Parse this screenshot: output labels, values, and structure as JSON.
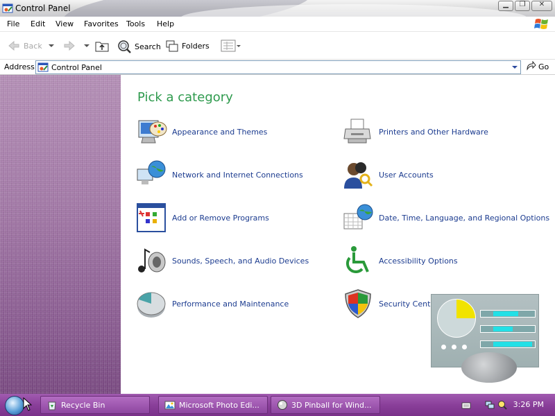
{
  "window": {
    "title": "Control Panel"
  },
  "menubar": {
    "items": [
      "File",
      "Edit",
      "View",
      "Favorites",
      "Tools",
      "Help"
    ]
  },
  "toolbar": {
    "back_label": "Back",
    "search_label": "Search",
    "folders_label": "Folders"
  },
  "addressbar": {
    "label": "Address",
    "value": "Control Panel",
    "go_label": "Go"
  },
  "main": {
    "heading": "Pick a category",
    "categories": [
      {
        "label": "Appearance and Themes",
        "icon": "appearance-themes-icon"
      },
      {
        "label": "Printers and Other Hardware",
        "icon": "printer-icon"
      },
      {
        "label": "Network and Internet Connections",
        "icon": "network-globe-icon"
      },
      {
        "label": "User Accounts",
        "icon": "user-accounts-icon"
      },
      {
        "label": "Add or Remove Programs",
        "icon": "add-remove-programs-icon"
      },
      {
        "label": "Date, Time, Language, and Regional Options",
        "icon": "date-time-globe-icon"
      },
      {
        "label": "Sounds, Speech, and Audio Devices",
        "icon": "speaker-note-icon"
      },
      {
        "label": "Accessibility Options",
        "icon": "accessibility-icon"
      },
      {
        "label": "Performance and Maintenance",
        "icon": "pie-chart-icon"
      },
      {
        "label": "Security Center",
        "icon": "security-shield-icon"
      }
    ]
  },
  "taskbar": {
    "buttons": [
      {
        "label": "Recycle Bin",
        "icon": "recycle-bin-icon"
      },
      {
        "label": "Microsoft Photo Edi...",
        "icon": "photo-editor-icon"
      },
      {
        "label": "3D Pinball for Wind...",
        "icon": "pinball-icon"
      }
    ],
    "clock": "3:26 PM"
  },
  "colors": {
    "heading_green": "#2e9a4d",
    "link_blue": "#1b3b8f",
    "taskbar_purple": "#8a3f9a",
    "taskpane_purple": "#a47aa8"
  }
}
